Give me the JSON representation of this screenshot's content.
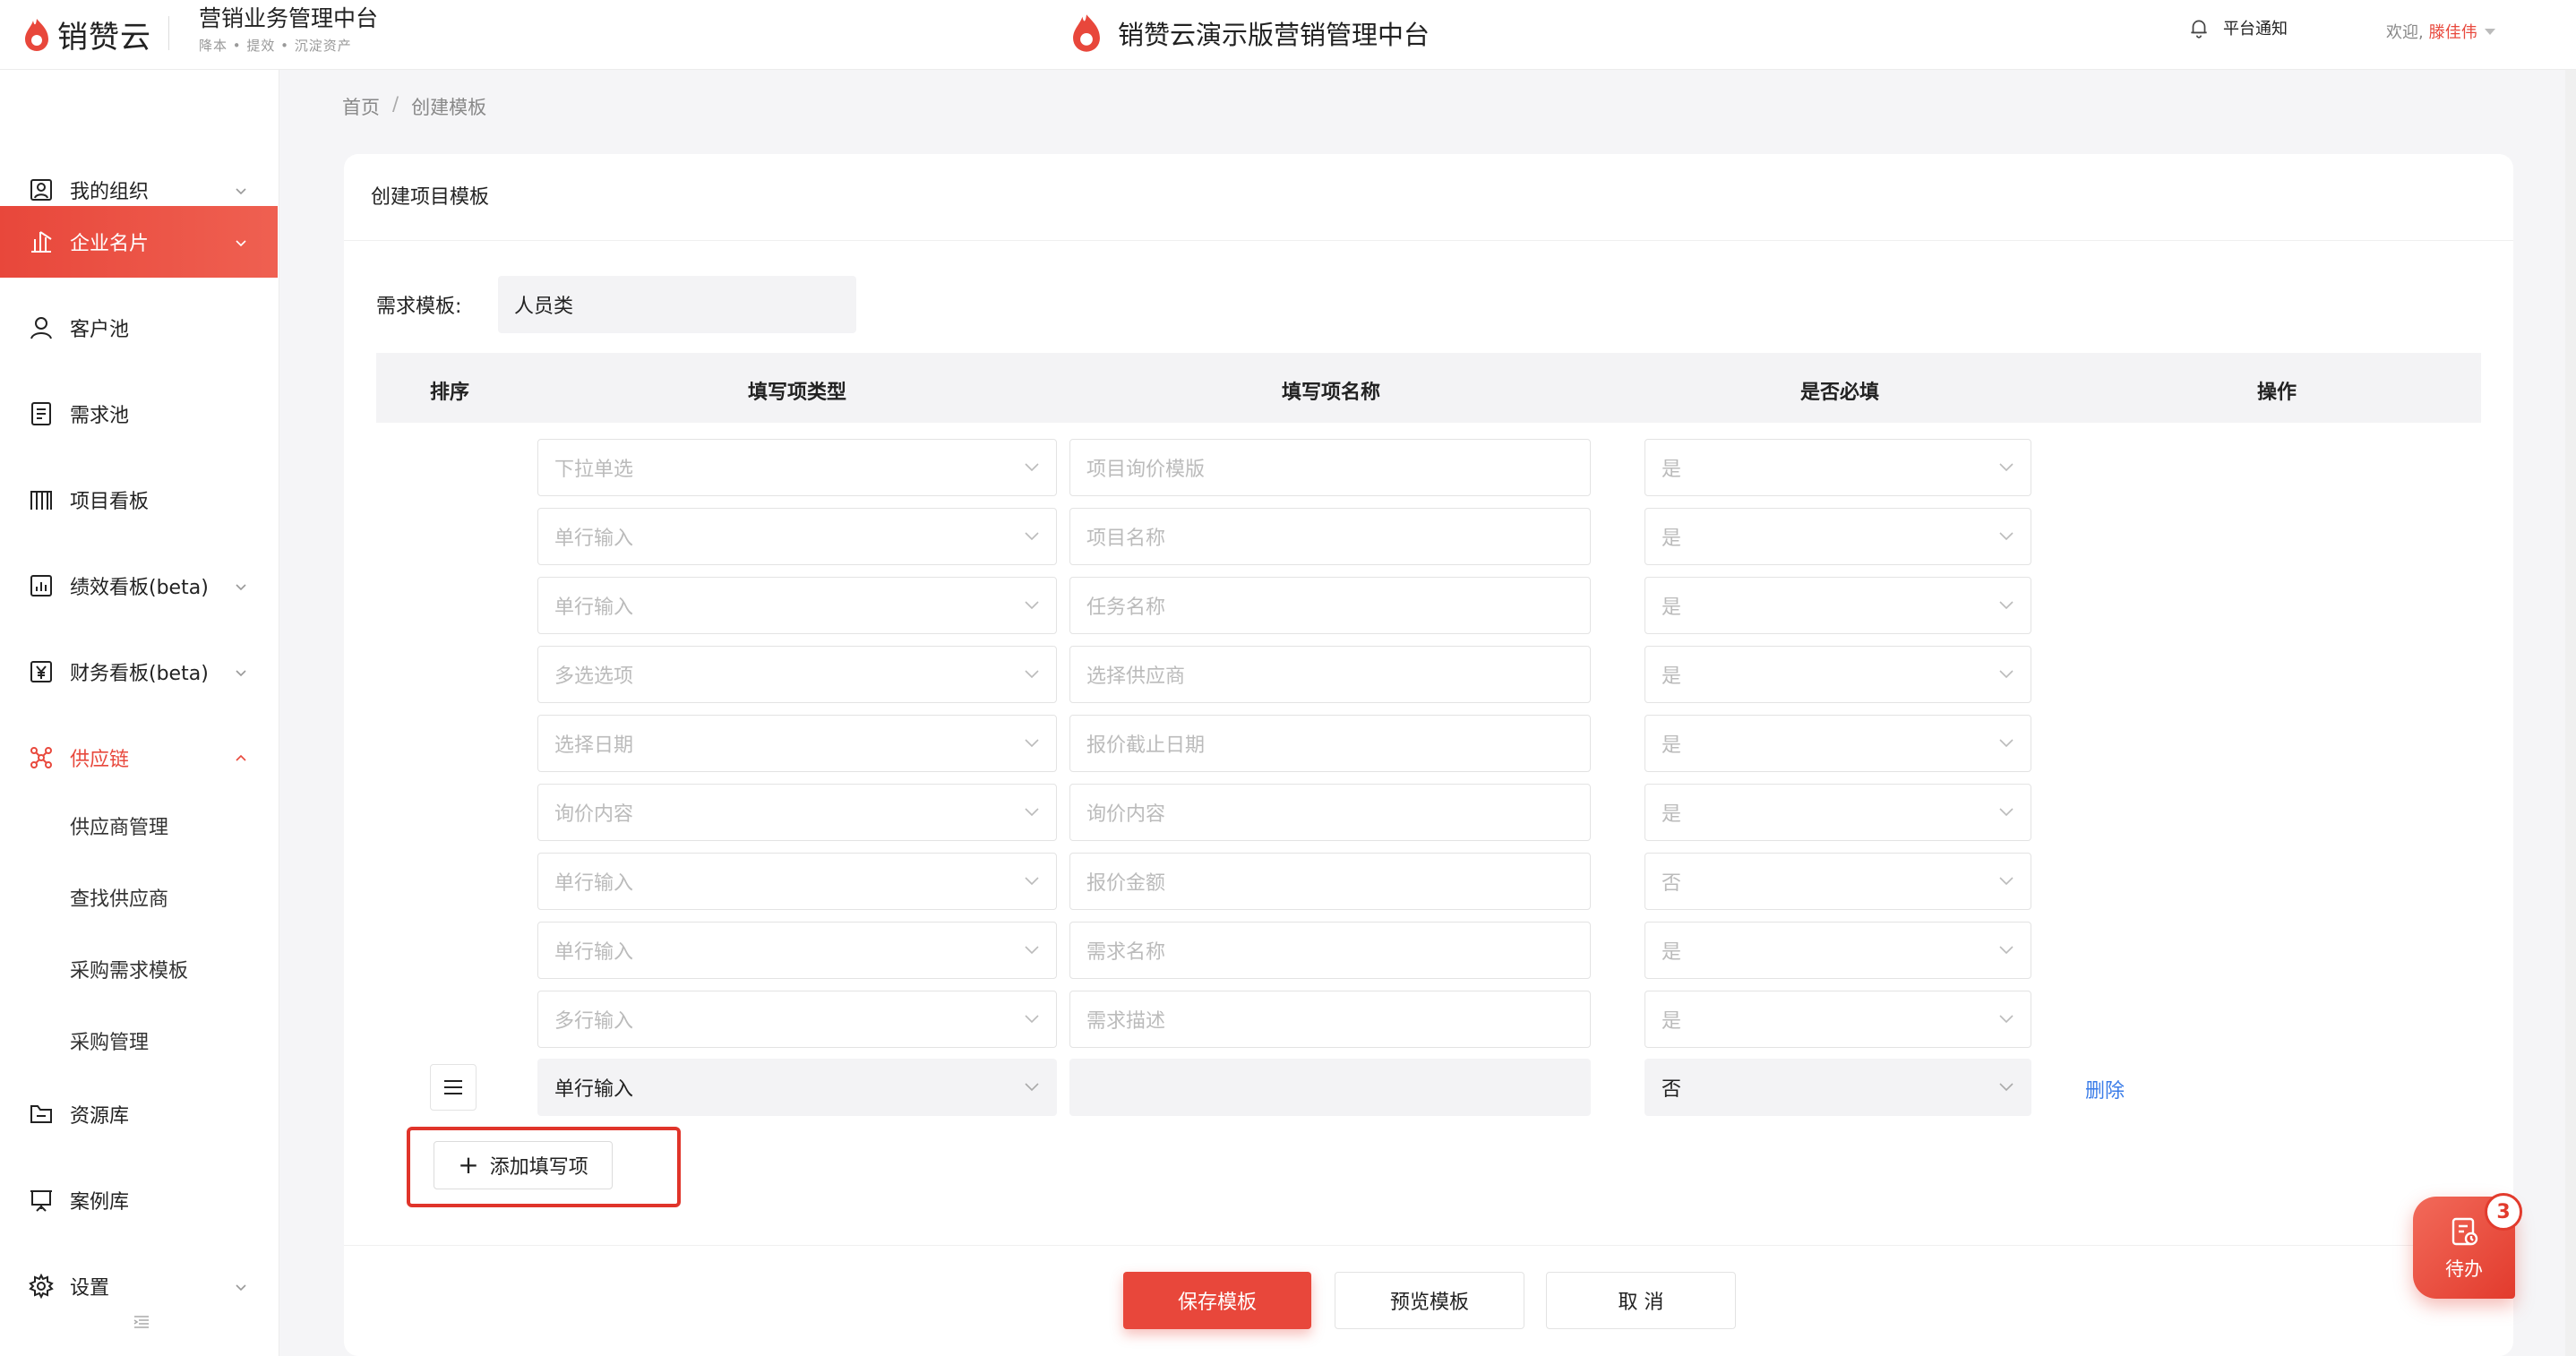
{
  "header": {
    "logo_text": "销赞云",
    "brand_title": "营销业务管理中台",
    "brand_subtitle": "降本 • 提效 • 沉淀资产",
    "center_title": "销赞云演示版营销管理中台",
    "notify_label": "平台通知",
    "welcome_label": "欢迎,",
    "user_name": "滕佳伟"
  },
  "sidebar": {
    "items": [
      {
        "label": "我的组织",
        "icon": "org-icon"
      },
      {
        "label": "企业名片",
        "icon": "building-icon"
      },
      {
        "label": "客户池",
        "icon": "user-icon"
      },
      {
        "label": "需求池",
        "icon": "document-icon"
      },
      {
        "label": "项目看板",
        "icon": "board-icon"
      },
      {
        "label": "绩效看板(beta)",
        "icon": "chart-icon"
      },
      {
        "label": "财务看板(beta)",
        "icon": "yen-icon"
      },
      {
        "label": "供应链",
        "icon": "network-icon"
      },
      {
        "label": "资源库",
        "icon": "folder-icon"
      },
      {
        "label": "案例库",
        "icon": "presentation-icon"
      },
      {
        "label": "设置",
        "icon": "gear-icon"
      }
    ],
    "sub_items": [
      "供应商管理",
      "查找供应商",
      "采购需求模板",
      "采购管理"
    ]
  },
  "breadcrumb": {
    "home": "首页",
    "separator": "/",
    "current": "创建模板"
  },
  "card": {
    "title": "创建项目模板",
    "template_label": "需求模板:",
    "template_value": "人员类"
  },
  "table": {
    "headers": [
      "排序",
      "填写项类型",
      "填写项名称",
      "是否必填",
      "操作"
    ],
    "rows": [
      {
        "type": "下拉单选",
        "name": "项目询价模版",
        "required": "是"
      },
      {
        "type": "单行输入",
        "name": "项目名称",
        "required": "是"
      },
      {
        "type": "单行输入",
        "name": "任务名称",
        "required": "是"
      },
      {
        "type": "多选选项",
        "name": "选择供应商",
        "required": "是"
      },
      {
        "type": "选择日期",
        "name": "报价截止日期",
        "required": "是"
      },
      {
        "type": "询价内容",
        "name": "询价内容",
        "required": "是"
      },
      {
        "type": "单行输入",
        "name": "报价金额",
        "required": "否"
      },
      {
        "type": "单行输入",
        "name": "需求名称",
        "required": "是"
      },
      {
        "type": "多行输入",
        "name": "需求描述",
        "required": "是"
      }
    ],
    "editable_row": {
      "type": "单行输入",
      "name": "",
      "required": "否",
      "action": "删除"
    }
  },
  "add_field_label": "添加填写项",
  "buttons": {
    "save": "保存模板",
    "preview": "预览模板",
    "cancel": "取 消"
  },
  "todo": {
    "label": "待办",
    "count": "3"
  },
  "colors": {
    "accent": "#e8473b",
    "link": "#3a7ce8"
  }
}
